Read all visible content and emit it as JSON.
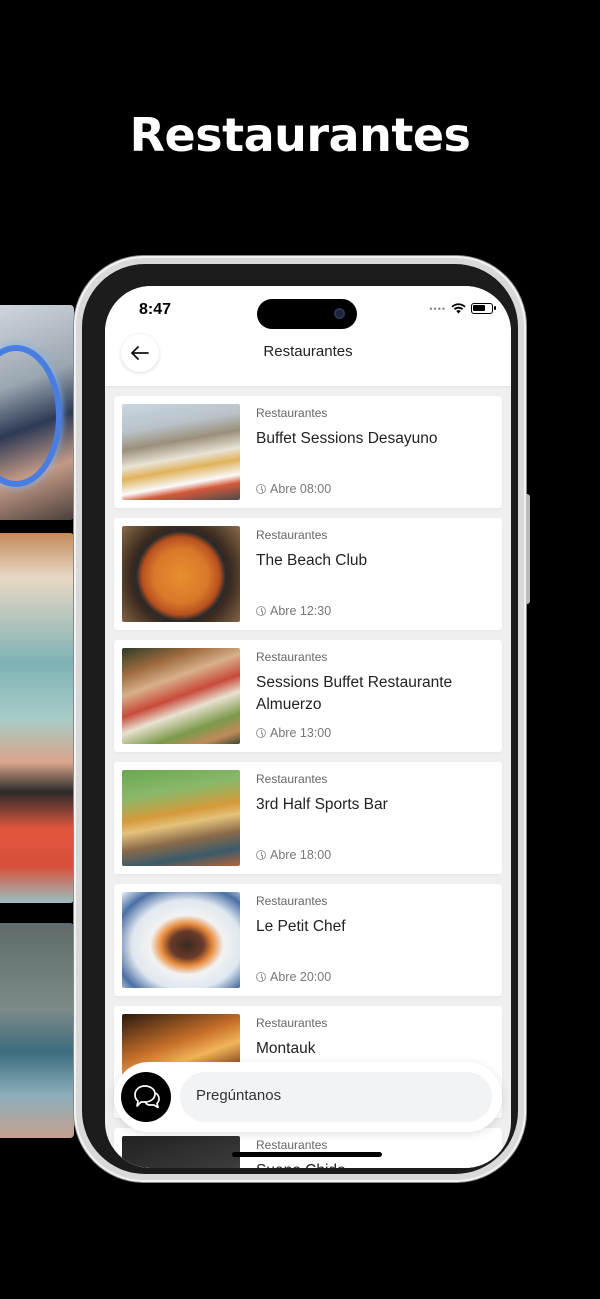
{
  "headline": "Restaurantes",
  "status": {
    "time": "8:47"
  },
  "navbar": {
    "title": "Restaurantes"
  },
  "restaurants": [
    {
      "category": "Restaurantes",
      "name": "Buffet Sessions Desayuno",
      "hours": "Abre 08:00"
    },
    {
      "category": "Restaurantes",
      "name": "The Beach Club",
      "hours": "Abre 12:30"
    },
    {
      "category": "Restaurantes",
      "name": "Sessions Buffet Restaurante Almuerzo",
      "hours": "Abre 13:00"
    },
    {
      "category": "Restaurantes",
      "name": "3rd Half Sports Bar",
      "hours": "Abre 18:00"
    },
    {
      "category": "Restaurantes",
      "name": "Le Petit Chef",
      "hours": "Abre 20:00"
    },
    {
      "category": "Restaurantes",
      "name": "Montauk",
      "hours": ""
    },
    {
      "category": "Restaurantes",
      "name": "Sueno Chido",
      "hours": ""
    }
  ],
  "ask": {
    "placeholder": "Pregúntanos"
  },
  "icons": {
    "back": "back-arrow-icon",
    "chat": "chat-bubbles-icon",
    "clock": "clock-icon"
  }
}
